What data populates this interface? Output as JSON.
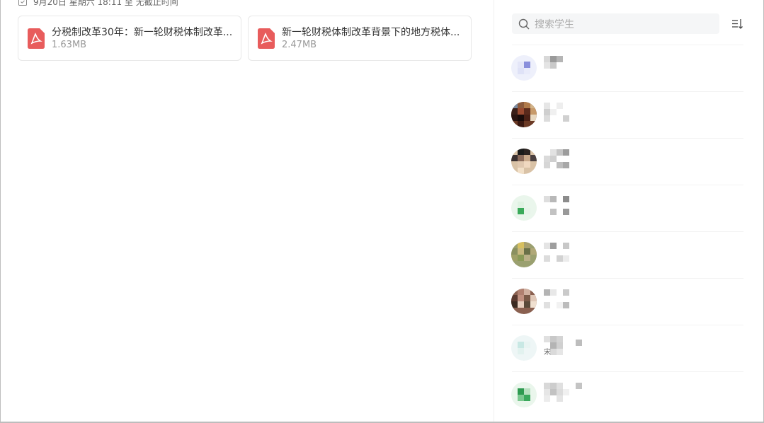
{
  "assignment": {
    "deadline_text": "9月20日 星期六 18:11 至 无截止时间"
  },
  "attachments": [
    {
      "name": "分税制改革30年：新一轮财税体制改革...",
      "size": "1.63MB",
      "icon": "pdf-icon"
    },
    {
      "name": "新一轮财税体制改革背景下的地方税体...",
      "size": "2.47MB",
      "icon": "pdf-icon"
    }
  ],
  "sidebar": {
    "search_placeholder": "搜索学生",
    "sort_icon": "sort-icon",
    "students": [
      {
        "name": "",
        "avatar_note": "pixelated"
      },
      {
        "name": "",
        "avatar_note": "pixelated"
      },
      {
        "name": "",
        "avatar_note": "pixelated"
      },
      {
        "name": "",
        "avatar_note": "pixelated"
      },
      {
        "name": "",
        "avatar_note": "pixelated"
      },
      {
        "name": "",
        "avatar_note": "pixelated"
      },
      {
        "name": "宋",
        "avatar_note": "pixelated"
      },
      {
        "name": "",
        "avatar_note": "pixelated"
      }
    ]
  },
  "colors": {
    "pdf_red": "#e85c5c",
    "card_border": "#e8e8e8",
    "search_bg": "#f5f6f7"
  }
}
